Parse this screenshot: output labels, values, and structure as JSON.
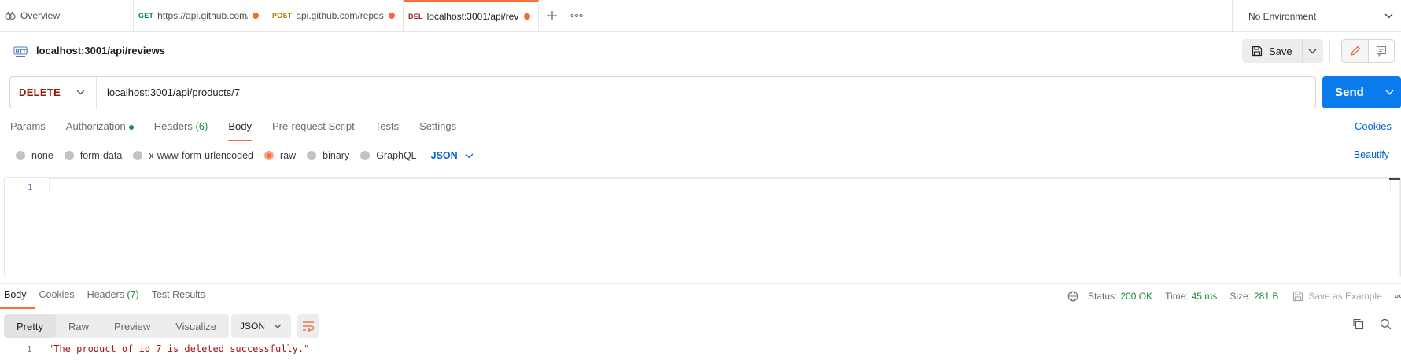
{
  "tabs": {
    "overview": "Overview",
    "items": [
      {
        "method": "GET",
        "label": "https://api.github.com/",
        "modified": true
      },
      {
        "method": "POST",
        "label": "api.github.com/repos",
        "modified": true
      },
      {
        "method": "DEL",
        "label": "localhost:3001/api/revi",
        "modified": true,
        "active": true
      }
    ],
    "new_tab_icon": "plus-icon",
    "more_icon": "more-horizontal-icon"
  },
  "environment": {
    "selected": "No Environment"
  },
  "request": {
    "title": "localhost:3001/api/reviews",
    "badge_icon": "http-icon",
    "save_label": "Save",
    "method": "DELETE",
    "url": "localhost:3001/api/products/7",
    "send_label": "Send"
  },
  "request_tabs": {
    "params": "Params",
    "authorization": "Authorization",
    "headers": "Headers",
    "headers_count": "(6)",
    "body": "Body",
    "prerequest": "Pre-request Script",
    "tests": "Tests",
    "settings": "Settings",
    "cookies": "Cookies"
  },
  "body_options": {
    "none": "none",
    "form_data": "form-data",
    "urlencoded": "x-www-form-urlencoded",
    "raw": "raw",
    "binary": "binary",
    "graphql": "GraphQL",
    "language": "JSON",
    "beautify": "Beautify"
  },
  "editor": {
    "line_number": "1"
  },
  "response": {
    "tabs": {
      "body": "Body",
      "cookies": "Cookies",
      "headers": "Headers",
      "headers_count": "(7)",
      "test_results": "Test Results"
    },
    "status_label": "Status:",
    "status_value": "200 OK",
    "time_label": "Time:",
    "time_value": "45 ms",
    "size_label": "Size:",
    "size_value": "281 B",
    "save_example": "Save as Example",
    "views": [
      "Pretty",
      "Raw",
      "Preview",
      "Visualize"
    ],
    "format": "JSON",
    "line_number": "1",
    "body_text": "\"The product of id 7 is deleted successfully.\""
  },
  "colors": {
    "accent": "#ff6c37",
    "send_button": "#097bed",
    "link": "#0265d2",
    "success": "#1d8a43",
    "delete_method": "#8e1a10"
  }
}
